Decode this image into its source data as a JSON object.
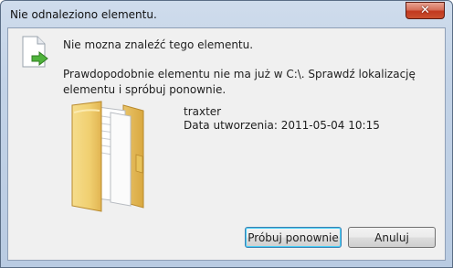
{
  "window": {
    "title": "Nie odnaleziono elementu.",
    "close_symbol": "✕"
  },
  "message": {
    "main": "Nie mozna znaleźć tego elementu.",
    "detail": "Prawdopodobnie elementu nie ma już w C:\\. Sprawdź lokalizację elementu i spróbuj ponownie."
  },
  "item": {
    "name": "traxter",
    "created": "Data utworzenia: 2011-05-04 10:15"
  },
  "buttons": {
    "retry": "Próbuj ponownie",
    "cancel": "Anuluj"
  },
  "icons": {
    "document": "document-arrow-icon",
    "folder": "folder-icon"
  }
}
